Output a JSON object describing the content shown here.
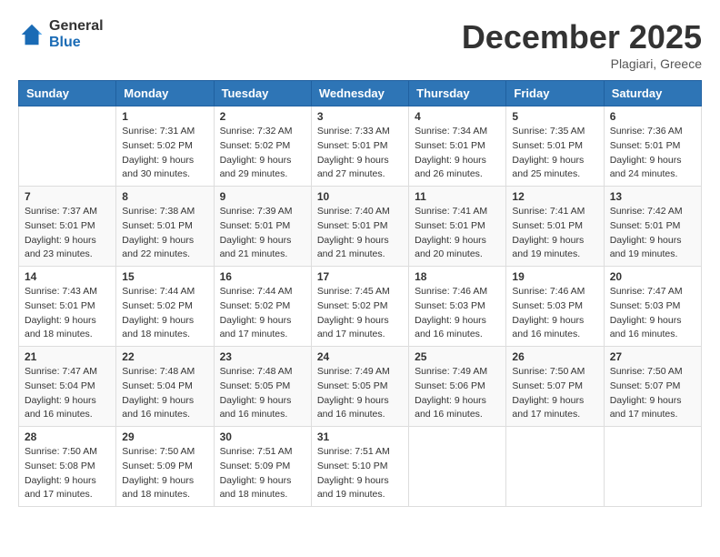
{
  "header": {
    "logo_general": "General",
    "logo_blue": "Blue",
    "month_title": "December 2025",
    "location": "Plagiari, Greece"
  },
  "days_of_week": [
    "Sunday",
    "Monday",
    "Tuesday",
    "Wednesday",
    "Thursday",
    "Friday",
    "Saturday"
  ],
  "weeks": [
    [
      {
        "day": "",
        "sunrise": "",
        "sunset": "",
        "daylight": ""
      },
      {
        "day": "1",
        "sunrise": "Sunrise: 7:31 AM",
        "sunset": "Sunset: 5:02 PM",
        "daylight": "Daylight: 9 hours and 30 minutes."
      },
      {
        "day": "2",
        "sunrise": "Sunrise: 7:32 AM",
        "sunset": "Sunset: 5:02 PM",
        "daylight": "Daylight: 9 hours and 29 minutes."
      },
      {
        "day": "3",
        "sunrise": "Sunrise: 7:33 AM",
        "sunset": "Sunset: 5:01 PM",
        "daylight": "Daylight: 9 hours and 27 minutes."
      },
      {
        "day": "4",
        "sunrise": "Sunrise: 7:34 AM",
        "sunset": "Sunset: 5:01 PM",
        "daylight": "Daylight: 9 hours and 26 minutes."
      },
      {
        "day": "5",
        "sunrise": "Sunrise: 7:35 AM",
        "sunset": "Sunset: 5:01 PM",
        "daylight": "Daylight: 9 hours and 25 minutes."
      },
      {
        "day": "6",
        "sunrise": "Sunrise: 7:36 AM",
        "sunset": "Sunset: 5:01 PM",
        "daylight": "Daylight: 9 hours and 24 minutes."
      }
    ],
    [
      {
        "day": "7",
        "sunrise": "Sunrise: 7:37 AM",
        "sunset": "Sunset: 5:01 PM",
        "daylight": "Daylight: 9 hours and 23 minutes."
      },
      {
        "day": "8",
        "sunrise": "Sunrise: 7:38 AM",
        "sunset": "Sunset: 5:01 PM",
        "daylight": "Daylight: 9 hours and 22 minutes."
      },
      {
        "day": "9",
        "sunrise": "Sunrise: 7:39 AM",
        "sunset": "Sunset: 5:01 PM",
        "daylight": "Daylight: 9 hours and 21 minutes."
      },
      {
        "day": "10",
        "sunrise": "Sunrise: 7:40 AM",
        "sunset": "Sunset: 5:01 PM",
        "daylight": "Daylight: 9 hours and 21 minutes."
      },
      {
        "day": "11",
        "sunrise": "Sunrise: 7:41 AM",
        "sunset": "Sunset: 5:01 PM",
        "daylight": "Daylight: 9 hours and 20 minutes."
      },
      {
        "day": "12",
        "sunrise": "Sunrise: 7:41 AM",
        "sunset": "Sunset: 5:01 PM",
        "daylight": "Daylight: 9 hours and 19 minutes."
      },
      {
        "day": "13",
        "sunrise": "Sunrise: 7:42 AM",
        "sunset": "Sunset: 5:01 PM",
        "daylight": "Daylight: 9 hours and 19 minutes."
      }
    ],
    [
      {
        "day": "14",
        "sunrise": "Sunrise: 7:43 AM",
        "sunset": "Sunset: 5:01 PM",
        "daylight": "Daylight: 9 hours and 18 minutes."
      },
      {
        "day": "15",
        "sunrise": "Sunrise: 7:44 AM",
        "sunset": "Sunset: 5:02 PM",
        "daylight": "Daylight: 9 hours and 18 minutes."
      },
      {
        "day": "16",
        "sunrise": "Sunrise: 7:44 AM",
        "sunset": "Sunset: 5:02 PM",
        "daylight": "Daylight: 9 hours and 17 minutes."
      },
      {
        "day": "17",
        "sunrise": "Sunrise: 7:45 AM",
        "sunset": "Sunset: 5:02 PM",
        "daylight": "Daylight: 9 hours and 17 minutes."
      },
      {
        "day": "18",
        "sunrise": "Sunrise: 7:46 AM",
        "sunset": "Sunset: 5:03 PM",
        "daylight": "Daylight: 9 hours and 16 minutes."
      },
      {
        "day": "19",
        "sunrise": "Sunrise: 7:46 AM",
        "sunset": "Sunset: 5:03 PM",
        "daylight": "Daylight: 9 hours and 16 minutes."
      },
      {
        "day": "20",
        "sunrise": "Sunrise: 7:47 AM",
        "sunset": "Sunset: 5:03 PM",
        "daylight": "Daylight: 9 hours and 16 minutes."
      }
    ],
    [
      {
        "day": "21",
        "sunrise": "Sunrise: 7:47 AM",
        "sunset": "Sunset: 5:04 PM",
        "daylight": "Daylight: 9 hours and 16 minutes."
      },
      {
        "day": "22",
        "sunrise": "Sunrise: 7:48 AM",
        "sunset": "Sunset: 5:04 PM",
        "daylight": "Daylight: 9 hours and 16 minutes."
      },
      {
        "day": "23",
        "sunrise": "Sunrise: 7:48 AM",
        "sunset": "Sunset: 5:05 PM",
        "daylight": "Daylight: 9 hours and 16 minutes."
      },
      {
        "day": "24",
        "sunrise": "Sunrise: 7:49 AM",
        "sunset": "Sunset: 5:05 PM",
        "daylight": "Daylight: 9 hours and 16 minutes."
      },
      {
        "day": "25",
        "sunrise": "Sunrise: 7:49 AM",
        "sunset": "Sunset: 5:06 PM",
        "daylight": "Daylight: 9 hours and 16 minutes."
      },
      {
        "day": "26",
        "sunrise": "Sunrise: 7:50 AM",
        "sunset": "Sunset: 5:07 PM",
        "daylight": "Daylight: 9 hours and 17 minutes."
      },
      {
        "day": "27",
        "sunrise": "Sunrise: 7:50 AM",
        "sunset": "Sunset: 5:07 PM",
        "daylight": "Daylight: 9 hours and 17 minutes."
      }
    ],
    [
      {
        "day": "28",
        "sunrise": "Sunrise: 7:50 AM",
        "sunset": "Sunset: 5:08 PM",
        "daylight": "Daylight: 9 hours and 17 minutes."
      },
      {
        "day": "29",
        "sunrise": "Sunrise: 7:50 AM",
        "sunset": "Sunset: 5:09 PM",
        "daylight": "Daylight: 9 hours and 18 minutes."
      },
      {
        "day": "30",
        "sunrise": "Sunrise: 7:51 AM",
        "sunset": "Sunset: 5:09 PM",
        "daylight": "Daylight: 9 hours and 18 minutes."
      },
      {
        "day": "31",
        "sunrise": "Sunrise: 7:51 AM",
        "sunset": "Sunset: 5:10 PM",
        "daylight": "Daylight: 9 hours and 19 minutes."
      },
      {
        "day": "",
        "sunrise": "",
        "sunset": "",
        "daylight": ""
      },
      {
        "day": "",
        "sunrise": "",
        "sunset": "",
        "daylight": ""
      },
      {
        "day": "",
        "sunrise": "",
        "sunset": "",
        "daylight": ""
      }
    ]
  ]
}
